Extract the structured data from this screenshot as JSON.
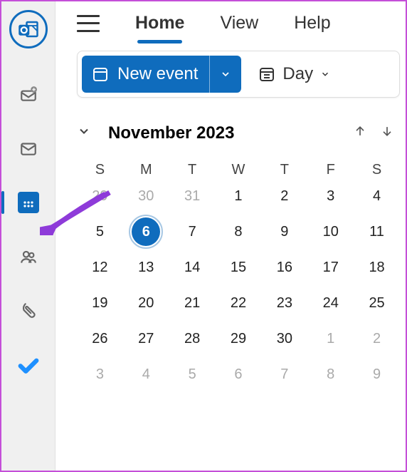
{
  "leftbar": {
    "logo": "outlook"
  },
  "tabs": {
    "home": "Home",
    "view": "View",
    "help": "Help"
  },
  "toolbar": {
    "new_event": "New event",
    "day": "Day"
  },
  "month": {
    "title": "November 2023"
  },
  "dow": [
    "S",
    "M",
    "T",
    "W",
    "T",
    "F",
    "S"
  ],
  "weeks": [
    [
      {
        "d": "29",
        "m": true
      },
      {
        "d": "30",
        "m": true
      },
      {
        "d": "31",
        "m": true
      },
      {
        "d": "1"
      },
      {
        "d": "2"
      },
      {
        "d": "3"
      },
      {
        "d": "4"
      }
    ],
    [
      {
        "d": "5"
      },
      {
        "d": "6",
        "sel": true
      },
      {
        "d": "7"
      },
      {
        "d": "8"
      },
      {
        "d": "9"
      },
      {
        "d": "10"
      },
      {
        "d": "11"
      }
    ],
    [
      {
        "d": "12"
      },
      {
        "d": "13"
      },
      {
        "d": "14"
      },
      {
        "d": "15"
      },
      {
        "d": "16"
      },
      {
        "d": "17"
      },
      {
        "d": "18"
      }
    ],
    [
      {
        "d": "19"
      },
      {
        "d": "20"
      },
      {
        "d": "21"
      },
      {
        "d": "22"
      },
      {
        "d": "23"
      },
      {
        "d": "24"
      },
      {
        "d": "25"
      }
    ],
    [
      {
        "d": "26"
      },
      {
        "d": "27"
      },
      {
        "d": "28"
      },
      {
        "d": "29"
      },
      {
        "d": "30"
      },
      {
        "d": "1",
        "m": true
      },
      {
        "d": "2",
        "m": true
      }
    ],
    [
      {
        "d": "3",
        "m": true
      },
      {
        "d": "4",
        "m": true
      },
      {
        "d": "5",
        "m": true
      },
      {
        "d": "6",
        "m": true
      },
      {
        "d": "7",
        "m": true
      },
      {
        "d": "8",
        "m": true
      },
      {
        "d": "9",
        "m": true
      }
    ]
  ]
}
